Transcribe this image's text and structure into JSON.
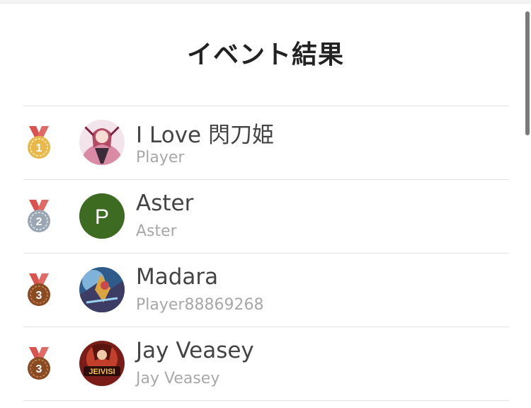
{
  "page": {
    "title": "イベント結果"
  },
  "results": [
    {
      "rank": "1",
      "medal": "gold-medal",
      "name": "I Love 閃刀姫",
      "subtitle": "Player",
      "avatar": "anime-character-avatar"
    },
    {
      "rank": "2",
      "medal": "silver-medal",
      "name": "Aster",
      "subtitle": "Aster",
      "avatar_letter": "P",
      "avatar_color": "#3d6b22"
    },
    {
      "rank": "3",
      "medal": "bronze-medal",
      "name": "Madara",
      "subtitle": "Player88869268",
      "avatar": "card-art-avatar"
    },
    {
      "rank": "3",
      "medal": "bronze-medal",
      "name": "Jay Veasey",
      "subtitle": "Jay Veasey",
      "avatar": "jeivisi-logo-avatar",
      "avatar_text": "JEIVISI"
    }
  ],
  "colors": {
    "gold": "#e9b84a",
    "silver": "#9aa6b2",
    "bronze": "#8a4a22",
    "ribbon": "#d9534f"
  }
}
